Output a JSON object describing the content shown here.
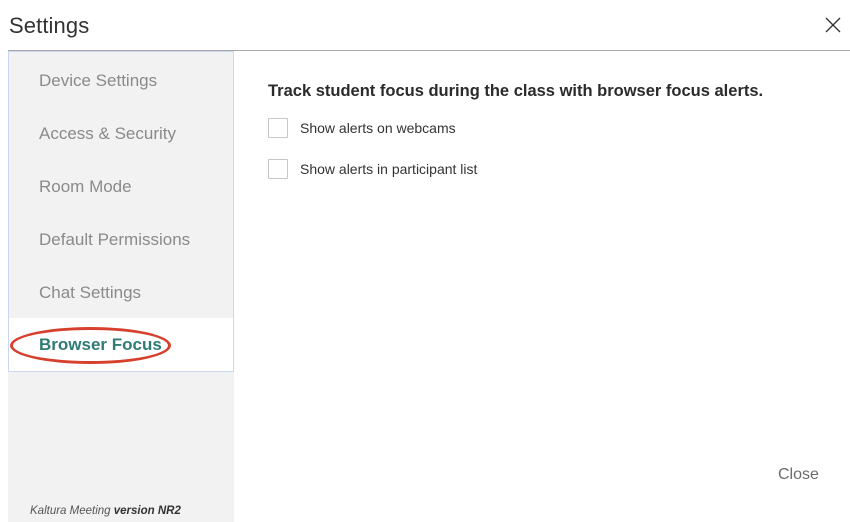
{
  "dialog": {
    "title": "Settings",
    "close_label": "Close"
  },
  "sidebar": {
    "items": [
      {
        "label": "Device Settings",
        "active": false
      },
      {
        "label": "Access & Security",
        "active": false
      },
      {
        "label": "Room Mode",
        "active": false
      },
      {
        "label": "Default Permissions",
        "active": false
      },
      {
        "label": "Chat Settings",
        "active": false
      },
      {
        "label": "Browser Focus",
        "active": true
      }
    ],
    "version": {
      "prefix": "Kaltura Meeting ",
      "value": "version NR2"
    }
  },
  "content": {
    "heading": "Track student focus during the class with browser focus alerts.",
    "options": [
      {
        "label": "Show alerts on webcams",
        "checked": false
      },
      {
        "label": "Show alerts in participant list",
        "checked": false
      }
    ]
  },
  "colors": {
    "active_text": "#2f7c75",
    "highlight_ring": "#d6402d",
    "sidebar_bg": "#f2f2f2"
  },
  "icons": {
    "close": "close-icon"
  }
}
